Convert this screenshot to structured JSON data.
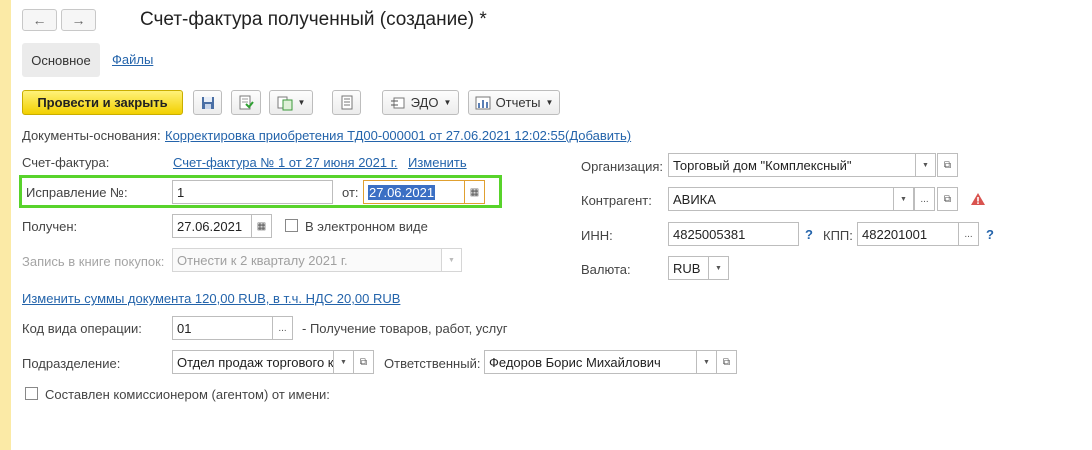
{
  "header": {
    "title": "Счет-фактура полученный (создание) *",
    "back_icon": "←",
    "forward_icon": "→"
  },
  "tabs": {
    "main": "Основное",
    "files": "Файлы"
  },
  "toolbar": {
    "post_close": "Провести и закрыть",
    "edo": "ЭДО",
    "reports": "Отчеты"
  },
  "base_docs": {
    "label": "Документы-основания:",
    "link": "Корректировка приобретения ТД00-000001 от 27.06.2021 12:02:55",
    "add": "(Добавить)"
  },
  "invoice": {
    "label": "Счет-фактура:",
    "link": "Счет-фактура № 1 от 27 июня 2021 г.",
    "change": "Изменить"
  },
  "correction": {
    "label": "Исправление №:",
    "number": "1",
    "from_label": "от:",
    "date": "27.06.2021"
  },
  "received": {
    "label": "Получен:",
    "date": "27.06.2021",
    "electronic_label": "В электронном виде"
  },
  "purchase_book": {
    "label": "Запись в книге покупок:",
    "value": "Отнести к 2 кварталу 2021 г."
  },
  "amount_link": "Изменить суммы документа 120,00 RUB, в т.ч. НДС 20,00 RUB",
  "operation": {
    "label": "Код вида операции:",
    "code": "01",
    "dots": "...",
    "description": "- Получение товаров, работ, услуг"
  },
  "department": {
    "label": "Подразделение:",
    "value": "Отдел продаж торгового к"
  },
  "responsible": {
    "label": "Ответственный:",
    "value": "Федоров Борис Михайлович"
  },
  "commission": {
    "label": "Составлен комиссионером (агентом) от имени:"
  },
  "organization": {
    "label": "Организация:",
    "value": "Торговый дом \"Комплексный\""
  },
  "counterparty": {
    "label": "Контрагент:",
    "value": "АВИКА",
    "dots": "..."
  },
  "inn": {
    "label": "ИНН:",
    "value": "4825005381",
    "help": "?"
  },
  "kpp": {
    "label": "КПП:",
    "value": "482201001",
    "dots": "...",
    "help": "?"
  },
  "currency": {
    "label": "Валюта:",
    "value": "RUB"
  },
  "colors": {
    "accent_link": "#2464ab",
    "primary_button": "#f2d000",
    "highlight_frame": "#58d32b",
    "warning": "#d9534f",
    "left_panel": "#fbeaa6"
  }
}
